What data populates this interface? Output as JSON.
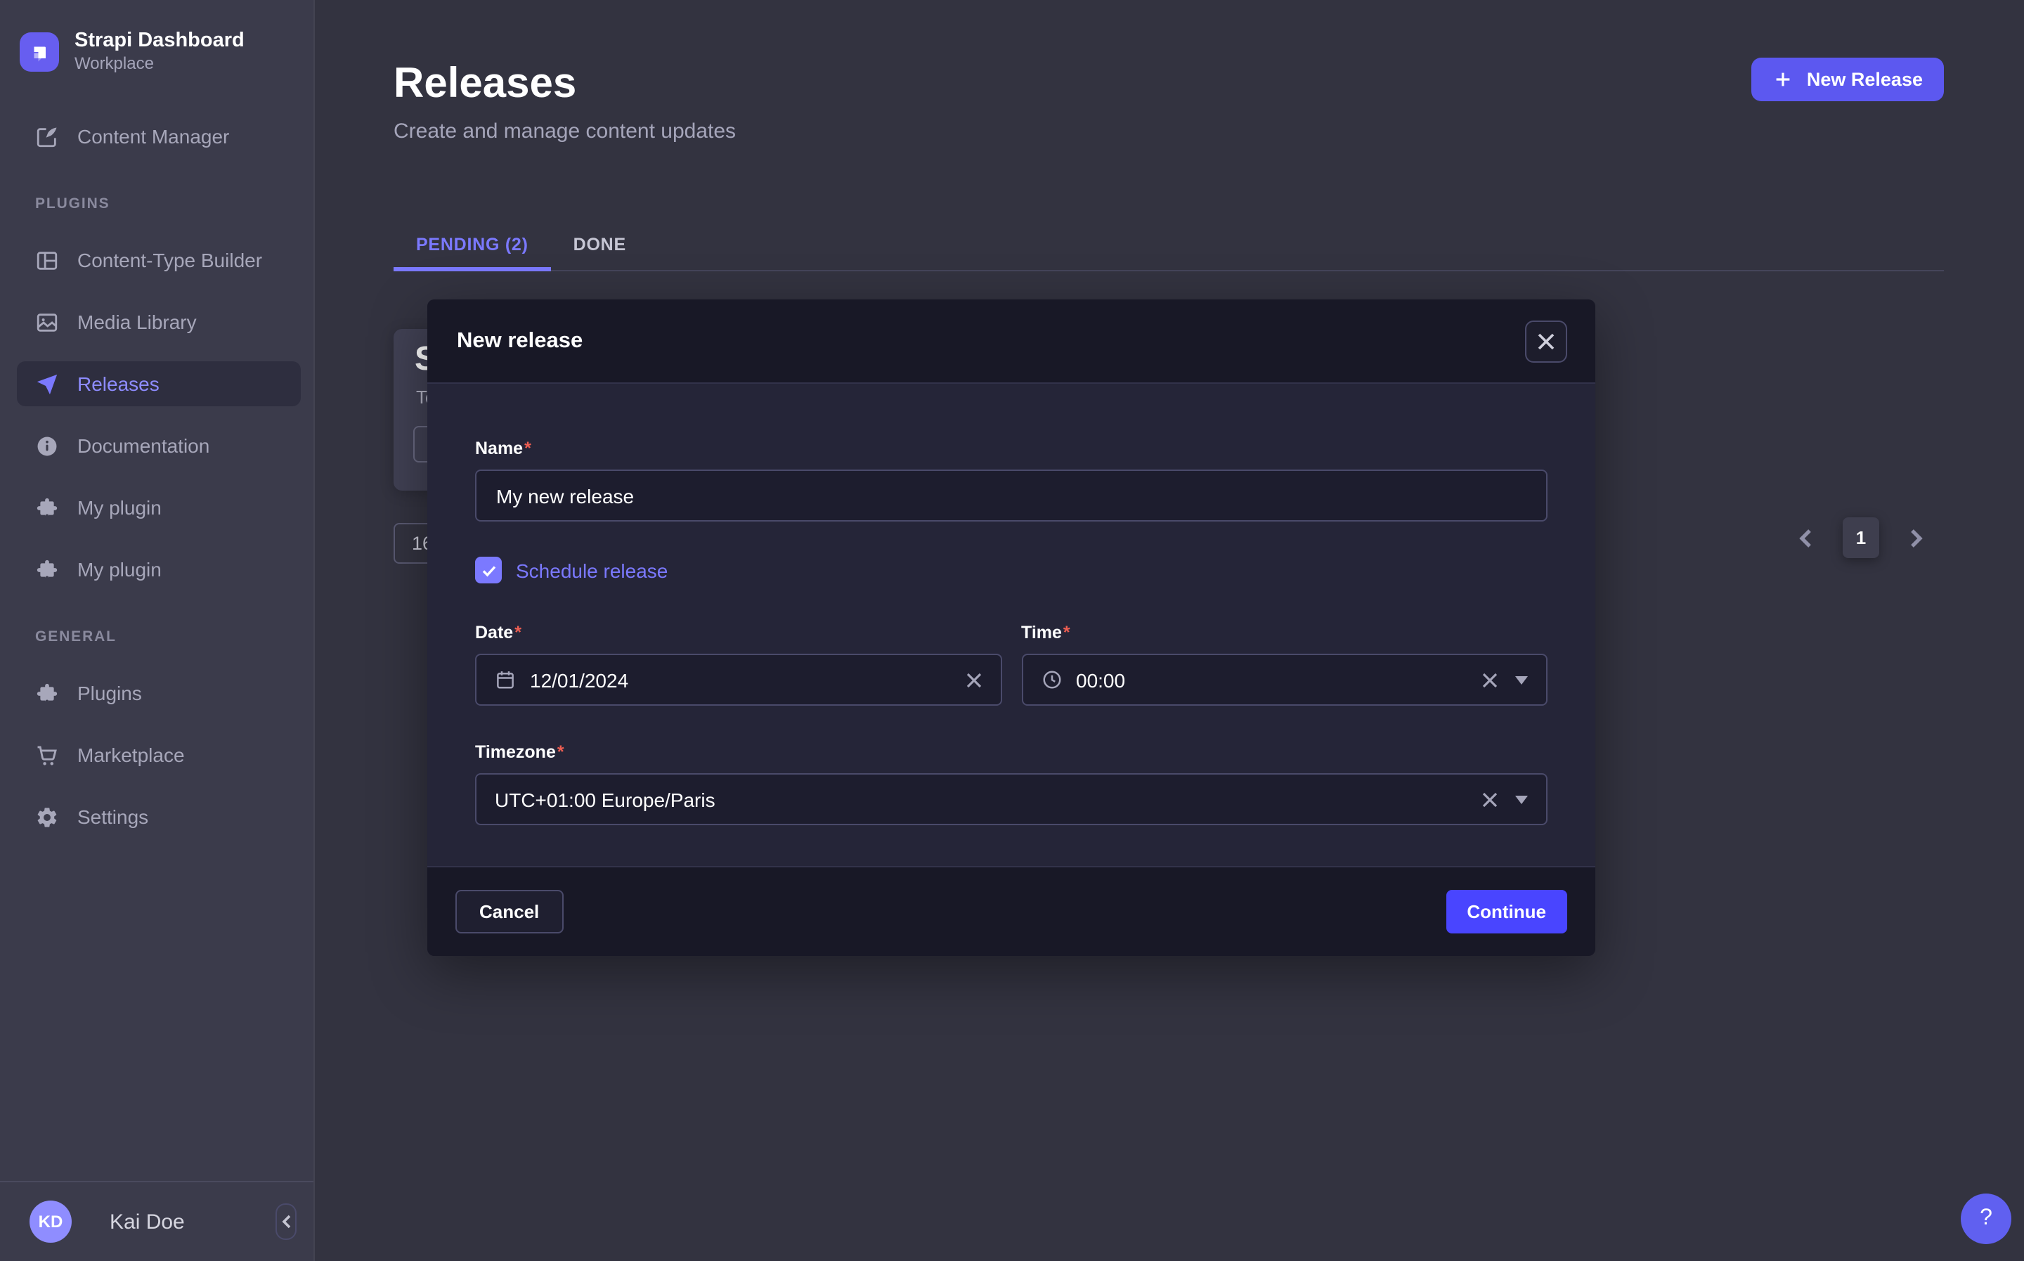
{
  "app": {
    "name": "Strapi Dashboard",
    "workspace": "Workplace",
    "logo_icon": "strapi-logo-icon"
  },
  "colors": {
    "accent": "#7b79ff",
    "primary_button": "#4945ff",
    "required_asterisk": "#ee5e52",
    "sidebar_bg": "#3b3b4b",
    "modal_bg": "#252538",
    "modal_header_bg": "#181826"
  },
  "sidebar": {
    "content_manager": {
      "label": "Content Manager",
      "icon": "feather-pen-icon"
    },
    "plugins_section": {
      "title": "PLUGINS",
      "items": [
        {
          "label": "Content-Type Builder",
          "icon": "layout-grid-icon",
          "active": false
        },
        {
          "label": "Media Library",
          "icon": "image-icon",
          "active": false
        },
        {
          "label": "Releases",
          "icon": "paper-plane-icon",
          "active": true
        },
        {
          "label": "Documentation",
          "icon": "info-circle-icon",
          "active": false
        },
        {
          "label": "My plugin",
          "icon": "puzzle-icon",
          "active": false
        },
        {
          "label": "My plugin",
          "icon": "puzzle-icon",
          "active": false
        }
      ]
    },
    "general_section": {
      "title": "GENERAL",
      "items": [
        {
          "label": "Plugins",
          "icon": "puzzle-icon",
          "active": false
        },
        {
          "label": "Marketplace",
          "icon": "cart-icon",
          "active": false
        },
        {
          "label": "Settings",
          "icon": "gear-icon",
          "active": false
        }
      ]
    },
    "user": {
      "initials": "KD",
      "name": "Kai Doe"
    },
    "collapse_icon": "chevron-left-icon"
  },
  "page": {
    "title": "Releases",
    "subtitle": "Create and manage content updates",
    "new_release_button": "New Release",
    "tabs": [
      {
        "label": "PENDING (2)",
        "active": true
      },
      {
        "label": "DONE",
        "active": false
      }
    ],
    "background_card": {
      "title_fragment": "S",
      "subtitle_fragment": "To"
    },
    "page_size_fragment": "16",
    "pagination": {
      "current_page": "1"
    }
  },
  "modal": {
    "title": "New release",
    "required_marker": "*",
    "fields": {
      "name": {
        "label": "Name",
        "value": "My new release"
      },
      "schedule": {
        "label": "Schedule release",
        "checked": true
      },
      "date": {
        "label": "Date",
        "value": "12/01/2024",
        "icon": "calendar-icon"
      },
      "time": {
        "label": "Time",
        "value": "00:00",
        "icon": "clock-icon"
      },
      "timezone": {
        "label": "Timezone",
        "value": "UTC+01:00 Europe/Paris"
      }
    },
    "cancel_label": "Cancel",
    "continue_label": "Continue"
  },
  "help": {
    "label": "?"
  }
}
